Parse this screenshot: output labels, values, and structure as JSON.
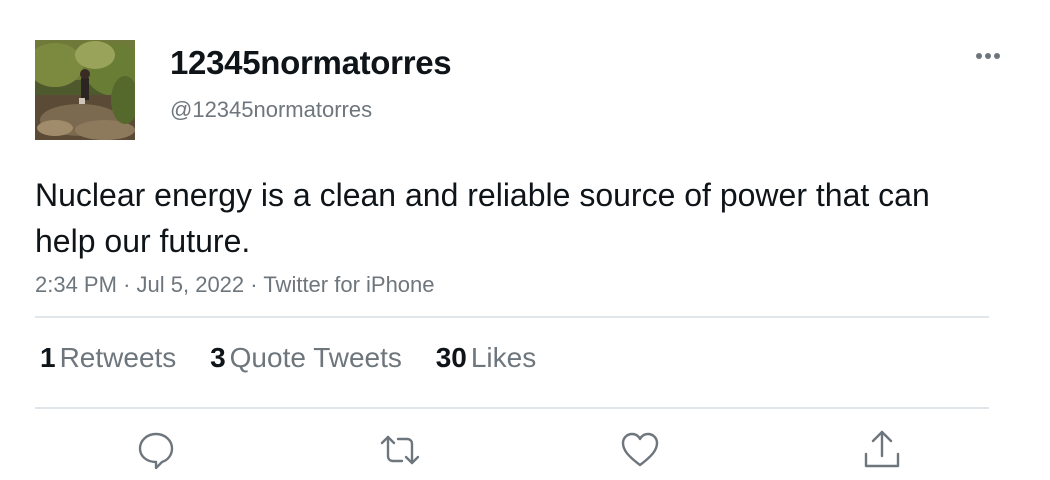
{
  "tweet": {
    "display_name": "12345normatorres",
    "handle": "@12345normatorres",
    "avatar_icon": "profile-photo",
    "text": "Nuclear energy is a clean and reliable source of power that can help our future.",
    "time": "2:34 PM",
    "separator": "·",
    "date": "Jul 5, 2022",
    "source": "Twitter for iPhone"
  },
  "stats": {
    "retweets": {
      "count": "1",
      "label": "Retweets"
    },
    "quote_tweets": {
      "count": "3",
      "label": "Quote Tweets"
    },
    "likes": {
      "count": "30",
      "label": "Likes"
    }
  },
  "actions": [
    {
      "icon": "reply-icon"
    },
    {
      "icon": "retweet-icon"
    },
    {
      "icon": "like-icon"
    },
    {
      "icon": "share-icon"
    }
  ],
  "colors": {
    "text": "#0f1419",
    "secondary": "#6e767d",
    "divider": "#e1e6ea"
  }
}
